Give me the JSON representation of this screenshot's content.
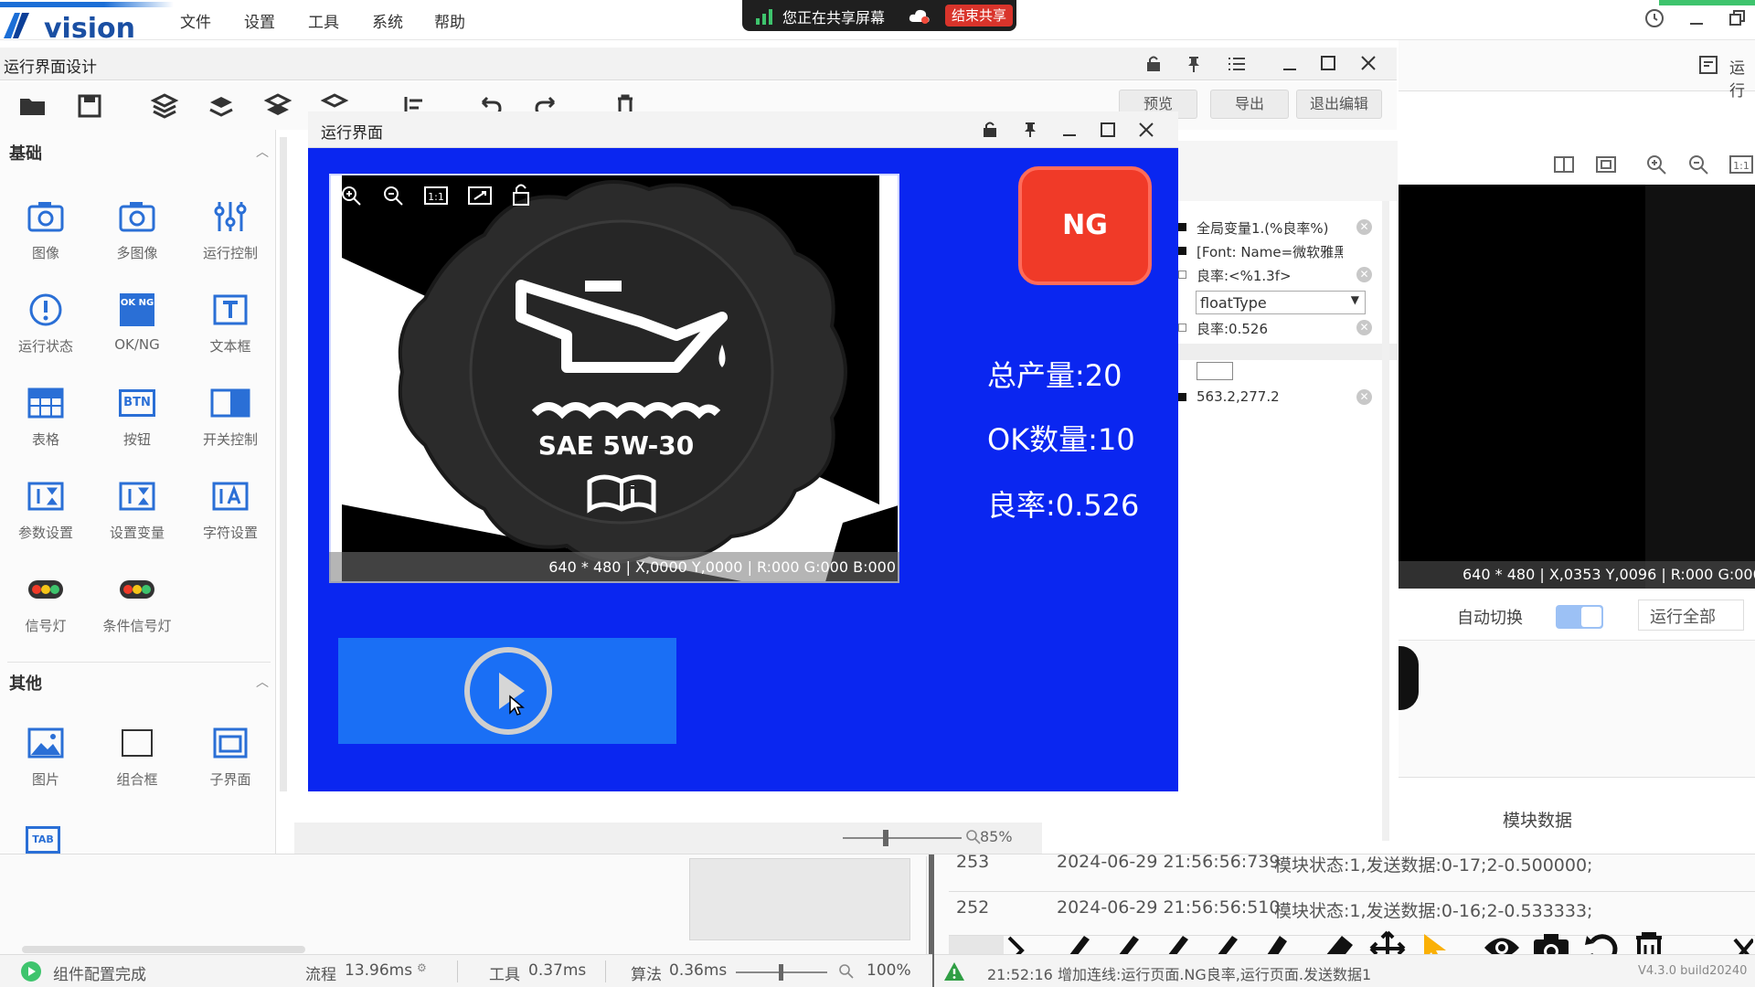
{
  "app": {
    "logo_text": "vision",
    "menu": [
      "文件",
      "设置",
      "工具",
      "系统",
      "帮助"
    ]
  },
  "share": {
    "message": "您正在共享屏幕",
    "stop_label": "结束共享"
  },
  "design_window": {
    "title": "运行界面设计",
    "buttons": {
      "preview": "预览",
      "export": "导出",
      "exit_edit": "退出编辑"
    }
  },
  "palette": {
    "basic_header": "基础",
    "basic_items": [
      "图像",
      "多图像",
      "运行控制",
      "运行状态",
      "OK/NG",
      "文本框",
      "表格",
      "按钮",
      "开关控制",
      "参数设置",
      "设置变量",
      "字符设置",
      "信号灯",
      "条件信号灯"
    ],
    "other_header": "其他",
    "other_items": [
      "图片",
      "组合框",
      "子界面"
    ],
    "icon_texts": {
      "ok_ng": "OK NG",
      "btn": "BTN",
      "tab": "TAB"
    }
  },
  "run_window": {
    "title": "运行界面",
    "image_status": "640 * 480  |  X,0000  Y,0000  |  R:000  G:000  B:000",
    "cap_text": "SAE 5W-30",
    "result_label": "NG",
    "total_label": "总产量:20",
    "ok_label": "OK数量:10",
    "yield_label": "良率:0.526",
    "zoom": "85%"
  },
  "props": {
    "rows": [
      "全局变量1.(%良率%)",
      "[Font: Name=微软雅黑",
      "良率:<%1.3f>",
      "良率:0.526",
      "563.2,277.2"
    ],
    "type_select": "floatType"
  },
  "right_panel": {
    "run_label": "运行",
    "status": "640 * 480  |  X,0353  Y,0096  |  R:000  G:000",
    "auto_switch": "自动切换",
    "run_all": "运行全部",
    "module_data": "模块数据"
  },
  "status_bar": {
    "message": "组件配置完成",
    "flow": "流程",
    "flow_time": "13.96ms",
    "tool": "工具",
    "tool_time": "0.37ms",
    "algo": "算法",
    "algo_time": "0.36ms",
    "zoom": "100%"
  },
  "log": {
    "rows": [
      {
        "id": "253",
        "time": "2024-06-29 21:56:56:739",
        "msg": "模块状态:1,发送数据:0-17;2-0.500000;"
      },
      {
        "id": "252",
        "time": "2024-06-29 21:56:56:510",
        "msg": "模块状态:1,发送数据:0-16;2-0.533333;"
      }
    ],
    "warning": "21:52:16  增加连线:运行页面.NG良率,运行页面.发送数据1",
    "version": "V4.3.0 build20240"
  },
  "colors": {
    "canvas_blue": "#0a26f0",
    "ng_red": "#f03a28",
    "play_blue": "#1a6ff5"
  }
}
